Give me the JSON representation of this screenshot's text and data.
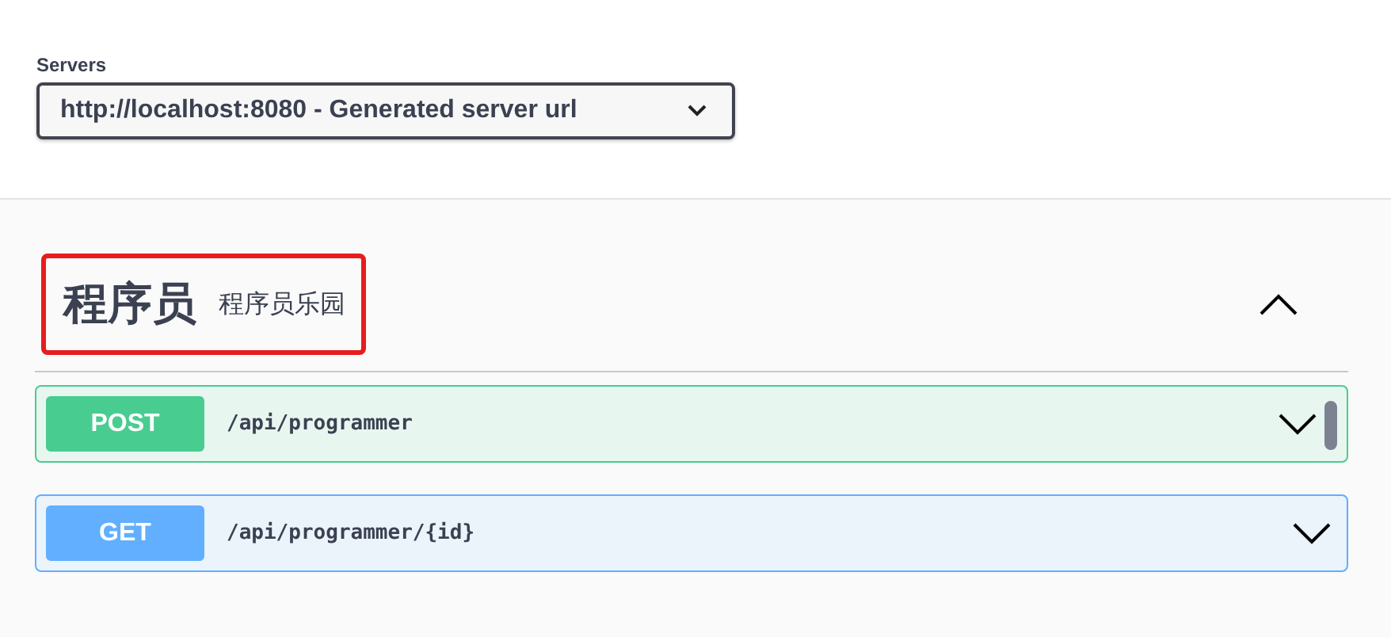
{
  "servers": {
    "label": "Servers",
    "value": "http://localhost:8080 - Generated server url"
  },
  "tag": {
    "name": "程序员",
    "description": "程序员乐园",
    "expanded": true,
    "highlighted": true
  },
  "operations": [
    {
      "method": "POST",
      "path": "/api/programmer",
      "hovered": true
    },
    {
      "method": "GET",
      "path": "/api/programmer/{id}",
      "hovered": false
    }
  ]
}
